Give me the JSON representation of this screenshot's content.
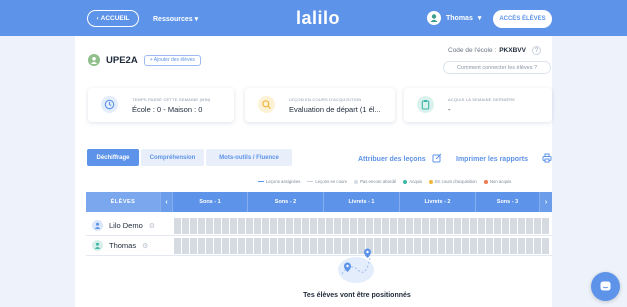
{
  "topbar": {
    "back_label": "ACCUEIL",
    "resources_label": "Ressources",
    "logo_text": "lalilo",
    "user_name": "Thomas",
    "access_students_label": "ACCÈS ÉLÈVES"
  },
  "class": {
    "name": "UPE2A",
    "add_students_label": "+ Ajouter des élèves",
    "school_code_label": "Code de l'école :",
    "school_code_value": "PKXBVV",
    "help_symbol": "?",
    "how_connect_label": "Comment connecter les élèves ?"
  },
  "stats": [
    {
      "label": "TEMPS PASSÉ CETTE SEMAINE (MIN)",
      "value": "École : 0 - Maison : 0",
      "icon": "clock-icon",
      "color": "#5d93e8"
    },
    {
      "label": "LEÇON EN COURS D'ACQUISITION",
      "value": "Evaluation de départ (1 él...",
      "icon": "search-icon",
      "color": "#f1b53a"
    },
    {
      "label": "ACQUIS LA SEMAINE DERNIÈRE",
      "value": "-",
      "icon": "clipboard-icon",
      "color": "#3fb6a8"
    }
  ],
  "tabs": [
    {
      "label": "Déchiffrage",
      "active": true
    },
    {
      "label": "Compréhension",
      "active": false
    },
    {
      "label": "Mots-outils / Fluence",
      "active": false
    }
  ],
  "actions": {
    "assign_label": "Attribuer des leçons",
    "print_label": "Imprimer les rapports"
  },
  "legend": [
    {
      "label": "Leçons assignées",
      "kind": "line",
      "color": "#5d93e8"
    },
    {
      "label": "Leçons en cours",
      "kind": "line",
      "color": "#c9d2de"
    },
    {
      "label": "Pas encore abordé",
      "kind": "dot",
      "color": "#d6dbe2"
    },
    {
      "label": "Acquis",
      "kind": "dot",
      "color": "#3fb6a8"
    },
    {
      "label": "En cours d'acquisition",
      "kind": "dot",
      "color": "#f1b53a"
    },
    {
      "label": "Non acquis",
      "kind": "dot",
      "color": "#f07a4f"
    }
  ],
  "table": {
    "students_header": "ÉLÈVES",
    "prev_arrow": "‹",
    "next_arrow": "›",
    "columns": [
      "Sons - 1",
      "Sons - 2",
      "Livrets - 1",
      "Livrets - 2",
      "Sons - 3"
    ],
    "rows": [
      {
        "name": "Lilo Demo",
        "avatar_color": "#d9e6fb",
        "icon": "lilo-avatar-icon"
      },
      {
        "name": "Thomas",
        "avatar_color": "#d6efe9",
        "icon": "thomas-avatar-icon"
      }
    ]
  },
  "empty_state": {
    "text": "Tes élèves vont être positionnés"
  },
  "colors": {
    "primary": "#5d93e8",
    "cell_empty": "#d6dbe2"
  }
}
